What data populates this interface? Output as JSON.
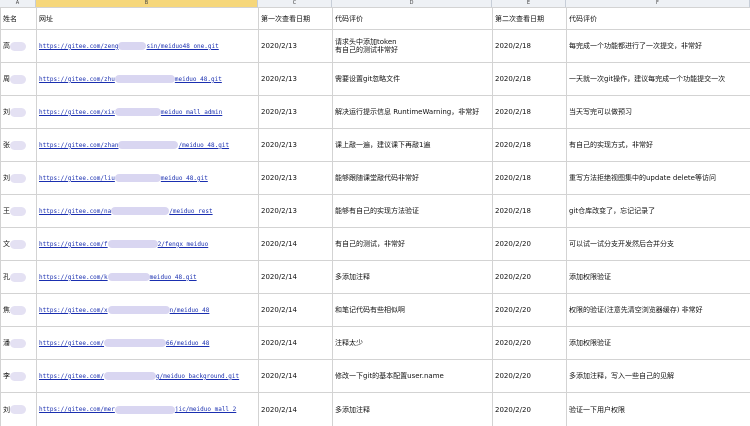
{
  "columns": [
    "A",
    "B",
    "C",
    "D",
    "E",
    "F"
  ],
  "selected_column": "B",
  "headers": [
    "姓名",
    "网址",
    "第一次查看日期",
    "代码评价",
    "第二次查看日期",
    "代码评价"
  ],
  "rows": [
    {
      "name": "高",
      "url_start": "https://gitee.com/zeng",
      "url_end": "sin/meiduo48_one.git",
      "date1": "2020/2/13",
      "comment1": "请求头中添加token\n有自己的测试非常好",
      "date2": "2020/2/18",
      "comment2": "每完成一个功能都进行了一次提交，非常好"
    },
    {
      "name": "周",
      "url_start": "https://gitee.com/zhu",
      "url_end": "meiduo_48.git",
      "date1": "2020/2/13",
      "comment1": "需要设置git忽略文件",
      "date2": "2020/2/18",
      "comment2": "一天就一次git操作，建议每完成一个功能提交一次"
    },
    {
      "name": "刘",
      "url_start": "https://gitee.com/xix",
      "url_end": "meiduo_mall_admin",
      "date1": "2020/2/13",
      "comment1": "解决运行提示信息 RuntimeWarning，非常好",
      "date2": "2020/2/18",
      "comment2": "当天写完可以做预习"
    },
    {
      "name": "张",
      "url_start": "https://gitee.com/zhan",
      "url_end": "/meiduo_48.git",
      "date1": "2020/2/13",
      "comment1": "课上敲一遍，建议课下再敲1遍",
      "date2": "2020/2/18",
      "comment2": "有自己的实现方式，非常好"
    },
    {
      "name": "刘",
      "url_start": "https://gitee.com/liu",
      "url_end": "meiduo_48.git",
      "date1": "2020/2/13",
      "comment1": "能够跟随课堂敲代码非常好",
      "date2": "2020/2/18",
      "comment2": "重写方法拒绝视图集中的update delete等访问"
    },
    {
      "name": "王",
      "url_start": "https://gitee.com/na",
      "url_end": "/meiduo_rest",
      "date1": "2020/2/13",
      "comment1": "能够有自己的实现方法验证",
      "date2": "2020/2/18",
      "comment2": "git仓库改变了，忘记记录了"
    },
    {
      "name": "文",
      "url_start": "https://gitee.com/f",
      "url_end": "2/fengx_meiduo",
      "date1": "2020/2/14",
      "comment1": "有自己的测试，非常好",
      "date2": "2020/2/20",
      "comment2": "可以试一试分支开发然后合并分支"
    },
    {
      "name": "孔",
      "url_start": "https://gitee.com/k",
      "url_end": "meiduo_48.git",
      "date1": "2020/2/14",
      "comment1": "多添加注释",
      "date2": "2020/2/20",
      "comment2": "添加权限验证"
    },
    {
      "name": "焦",
      "url_start": "https://gitee.com/x",
      "url_end": "n/meiduo_48",
      "date1": "2020/2/14",
      "comment1": "和笔记代码有些相似啊",
      "date2": "2020/2/20",
      "comment2": "权限的验证(注意先清空浏览器缓存) 非常好"
    },
    {
      "name": "潘",
      "url_start": "https://gitee.com/",
      "url_end": "66/meiduo_48",
      "date1": "2020/2/14",
      "comment1": "注释太少",
      "date2": "2020/2/20",
      "comment2": "添加权限验证"
    },
    {
      "name": "李",
      "url_start": "https://gitee.com/",
      "url_end": "g/meiduo_background.git",
      "date1": "2020/2/14",
      "comment1": "修改一下git的基本配置user.name",
      "date2": "2020/2/20",
      "comment2": "多添加注释，写入一些自己的见解"
    },
    {
      "name": "刘",
      "url_start": "https://gitee.com/mer",
      "url_end": "jic/meiduo_mall_2",
      "date1": "2020/2/14",
      "comment1": "多添加注释",
      "date2": "2020/2/20",
      "comment2": "验证一下用户权限"
    }
  ]
}
